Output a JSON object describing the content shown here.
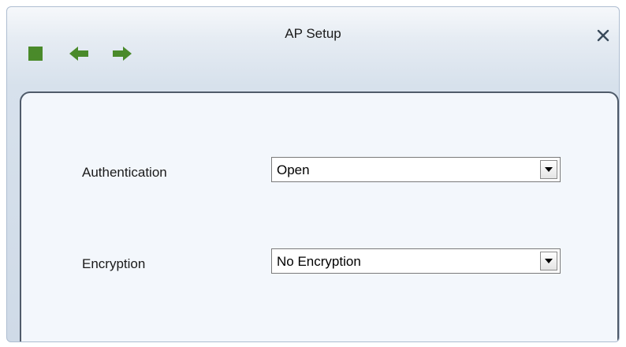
{
  "window": {
    "title": "AP Setup"
  },
  "toolbar": {
    "icons": [
      "stop-square-icon",
      "back-arrow-icon",
      "forward-arrow-icon"
    ],
    "icon_color": "#4a8a2a"
  },
  "form": {
    "authentication": {
      "label": "Authentication",
      "value": "Open"
    },
    "encryption": {
      "label": "Encryption",
      "value": "No Encryption"
    }
  }
}
